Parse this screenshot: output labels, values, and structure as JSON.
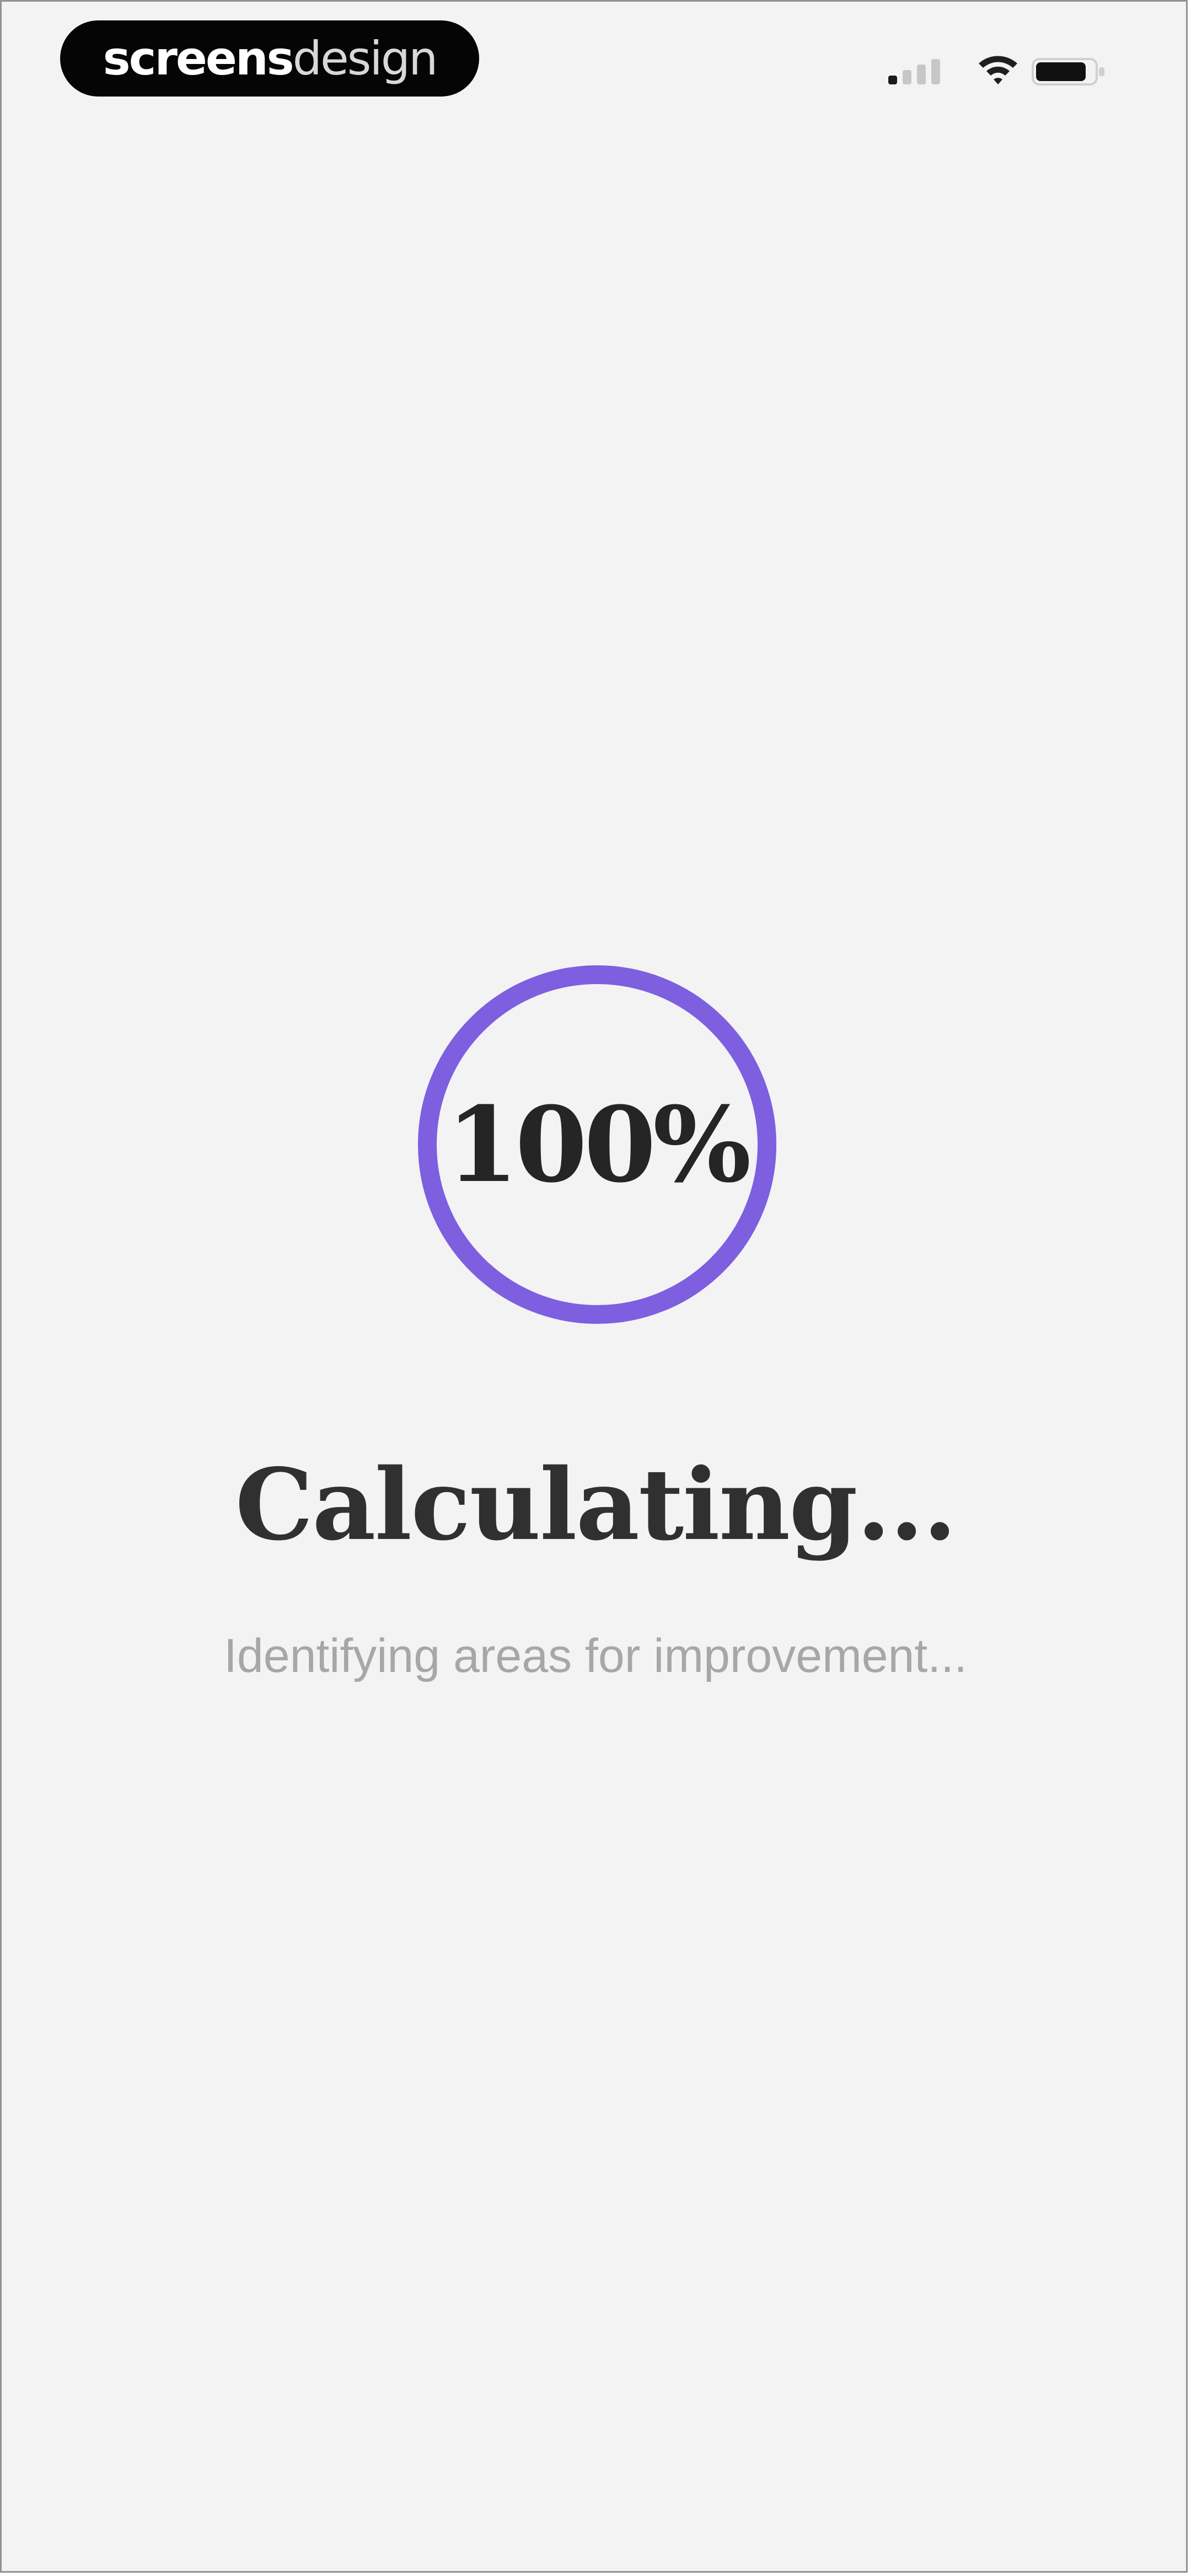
{
  "status_bar": {
    "brand_bold": "screens",
    "brand_light": "design",
    "icons": [
      "signal-icon",
      "wifi-icon",
      "battery-icon"
    ]
  },
  "progress": {
    "value": 1.0,
    "label": "100%"
  },
  "heading": "Calculating...",
  "subtext": "Identifying areas for improvement...",
  "colors": {
    "background": "#f3f3f3",
    "accent": "#7d5fe0",
    "text": "#303030",
    "muted": "#a7a7a7"
  }
}
